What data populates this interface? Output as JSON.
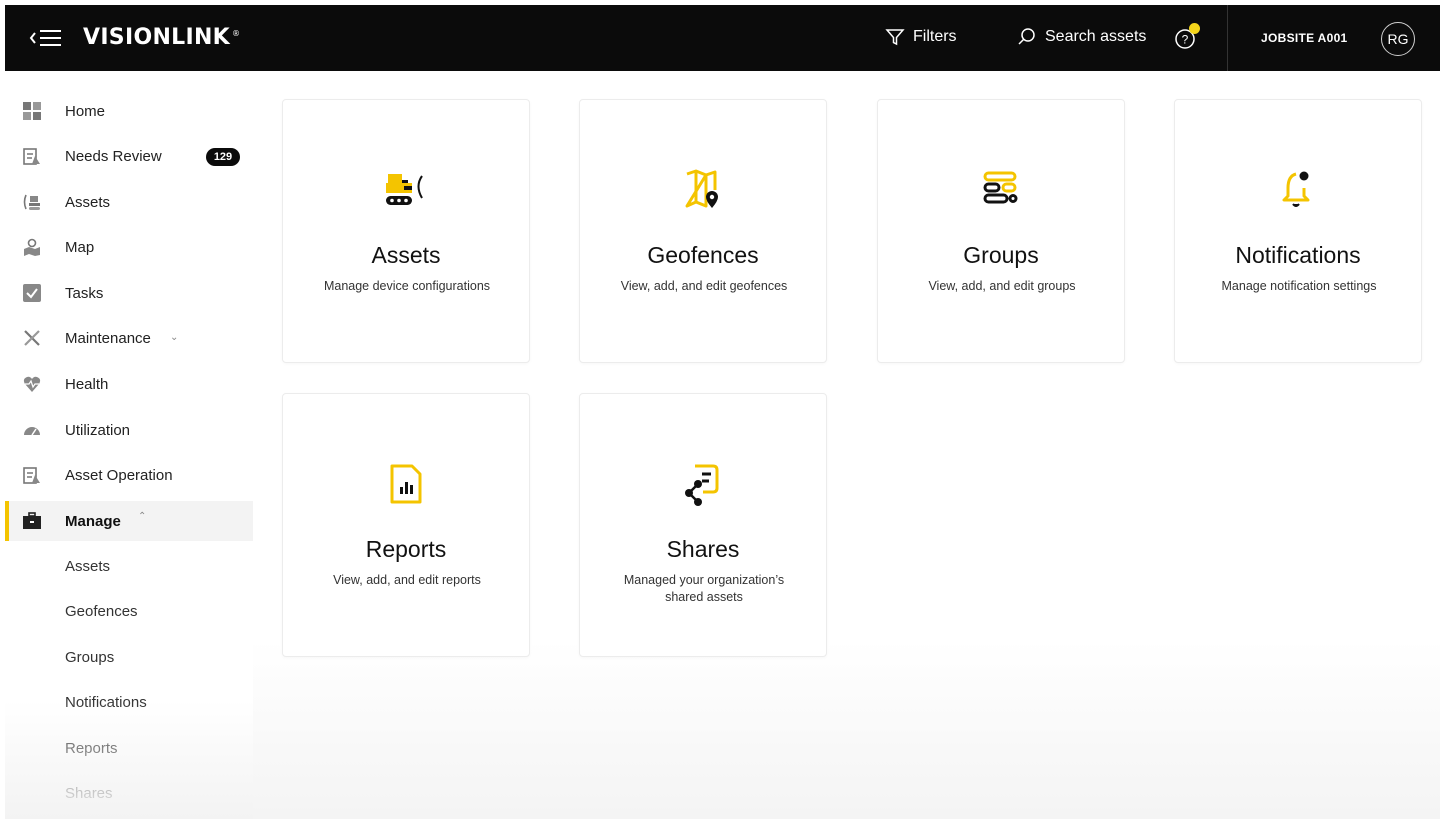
{
  "header": {
    "logo": "VISIONLINK",
    "logo_mark": "®",
    "filters_label": "Filters",
    "search_label": "Search assets",
    "jobsite": "JOBSITE A001",
    "avatar_initials": "RG"
  },
  "sidebar": {
    "items": [
      {
        "label": "Home",
        "icon": "grid-icon"
      },
      {
        "label": "Needs Review",
        "icon": "review-icon",
        "badge": "129"
      },
      {
        "label": "Assets",
        "icon": "assets-icon"
      },
      {
        "label": "Map",
        "icon": "map-icon"
      },
      {
        "label": "Tasks",
        "icon": "tasks-icon"
      },
      {
        "label": "Maintenance",
        "icon": "tools-icon"
      },
      {
        "label": "Health",
        "icon": "health-icon"
      },
      {
        "label": "Utilization",
        "icon": "gauge-icon"
      },
      {
        "label": "Asset Operation",
        "icon": "operation-icon"
      },
      {
        "label": "Manage",
        "icon": "briefcase-icon"
      }
    ],
    "manage_sub": [
      "Assets",
      "Geofences",
      "Groups",
      "Notifications",
      "Reports",
      "Shares"
    ]
  },
  "cards": [
    {
      "title": "Assets",
      "desc": "Manage device configurations",
      "icon": "excavator-icon"
    },
    {
      "title": "Geofences",
      "desc": "View, add, and edit geofences",
      "icon": "geofence-map-icon"
    },
    {
      "title": "Groups",
      "desc": "View, add, and edit groups",
      "icon": "groups-icon"
    },
    {
      "title": "Notifications",
      "desc": "Manage notification settings",
      "icon": "bell-icon"
    },
    {
      "title": "Reports",
      "desc": "View, add, and edit reports",
      "icon": "report-icon"
    },
    {
      "title": "Shares",
      "desc": "Managed your organization’s shared assets",
      "icon": "share-icon"
    }
  ],
  "colors": {
    "accent": "#f4c400",
    "topbar": "#0b0b0b",
    "notification_dot": "#f4d51b"
  }
}
